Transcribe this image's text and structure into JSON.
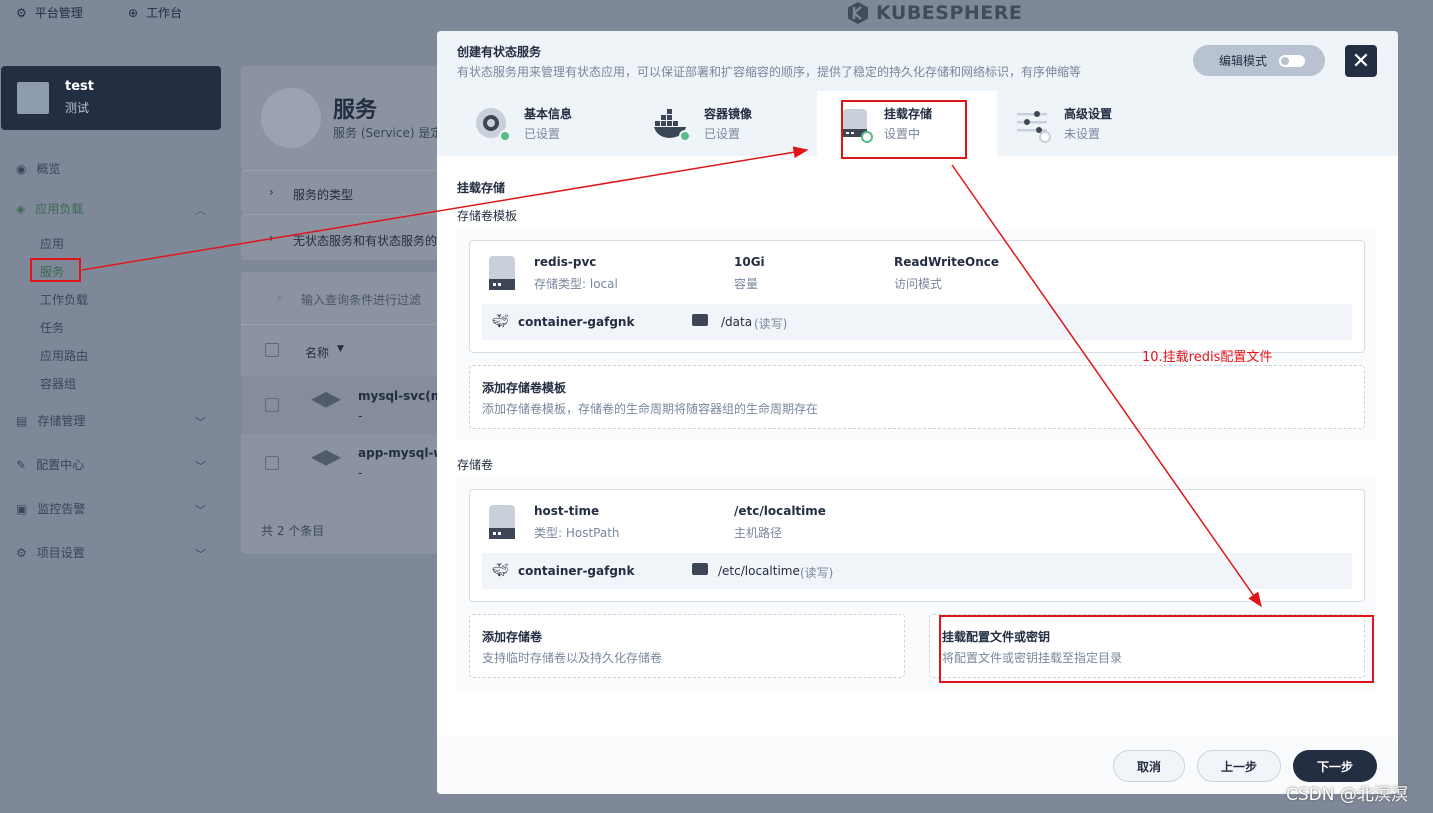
{
  "topbar": {
    "platform": "平台管理",
    "workbench": "工作台",
    "logo": "KUBESPHERE"
  },
  "project": {
    "name": "test",
    "alias": "测试"
  },
  "sidebar": {
    "overview": "概览",
    "workloads": "应用负载",
    "items": [
      "应用",
      "服务",
      "工作负载",
      "任务",
      "应用路由",
      "容器组"
    ],
    "storage": "存储管理",
    "config": "配置中心",
    "monitoring": "监控告警",
    "settings": "项目设置"
  },
  "background": {
    "title": "服务",
    "desc": "服务 (Service) 是定",
    "type_row": "服务的类型",
    "type_row2": "无状态服务和有状态服务的",
    "search_placeholder": "输入查询条件进行过滤",
    "col_name": "名称",
    "rows": [
      {
        "name": "mysql-svc(mys",
        "sub": "-"
      },
      {
        "name": "app-mysql-wyu",
        "sub": "-"
      }
    ],
    "total": "共 2 个条目"
  },
  "modal": {
    "title": "创建有状态服务",
    "desc": "有状态服务用来管理有状态应用，可以保证部署和扩容缩容的顺序，提供了稳定的持久化存储和网络标识，有序伸缩等",
    "edit_mode": "编辑模式",
    "close": "✕",
    "tabs": [
      {
        "label": "基本信息",
        "status": "已设置"
      },
      {
        "label": "容器镜像",
        "status": "已设置"
      },
      {
        "label": "挂载存储",
        "status": "设置中"
      },
      {
        "label": "高级设置",
        "status": "未设置"
      }
    ],
    "section_mount": "挂载存储",
    "section_template": "存储卷模板",
    "template": {
      "name": "redis-pvc",
      "type": "存储类型: local",
      "capacity": "10Gi",
      "capacity_label": "容量",
      "access": "ReadWriteOnce",
      "access_label": "访问模式",
      "container": "container-gafgnk",
      "path": "/data",
      "mode": "(读写)"
    },
    "add_template": {
      "title": "添加存储卷模板",
      "desc": "添加存储卷模板，存储卷的生命周期将随容器组的生命周期存在"
    },
    "section_volume": "存储卷",
    "volume": {
      "name": "host-time",
      "type": "类型: HostPath",
      "path_value": "/etc/localtime",
      "path_label": "主机路径",
      "container": "container-gafgnk",
      "path": "/etc/localtime",
      "mode": "(读写)"
    },
    "add_volume": {
      "title": "添加存储卷",
      "desc": "支持临时存储卷以及持久化存储卷"
    },
    "mount_config": {
      "title": "挂载配置文件或密钥",
      "desc": "将配置文件或密钥挂载至指定目录"
    },
    "buttons": {
      "cancel": "取消",
      "prev": "上一步",
      "next": "下一步"
    }
  },
  "annotation": "10.挂载redis配置文件",
  "watermark": "CSDN @北溟溟",
  "colors": {
    "annotation_red": "#e0151a",
    "dark": "#242e42",
    "success": "#55bc8a"
  }
}
